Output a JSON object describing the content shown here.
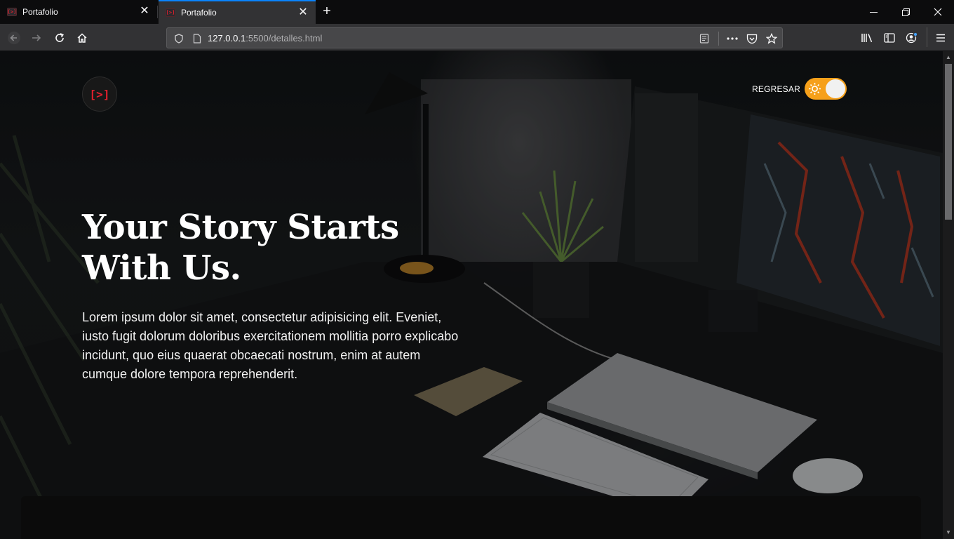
{
  "browser": {
    "tabs": [
      {
        "title": "Portafolio",
        "active": false
      },
      {
        "title": "Portafolio",
        "active": true
      }
    ],
    "tab_favicon_text": "[>]",
    "url_host": "127.0.0.1",
    "url_path": ":5500/detalles.html",
    "accent_color": "#0a84ff"
  },
  "page": {
    "logo_text": "[>]",
    "back_label": "REGRESAR",
    "theme_toggle": {
      "on": true,
      "color": "#f6a01a"
    },
    "hero": {
      "title_line1": "Your Story Starts",
      "title_line2": "With Us.",
      "text_line1": "Lorem ipsum dolor sit amet, consectetur adipisicing elit. Eveniet,",
      "text_line2": "iusto fugit dolorum doloribus exercitationem mollitia porro explicabo",
      "text_line3": "incidunt, quo eius quaerat obcaecati nostrum, enim at autem",
      "text_line4": "cumque dolore tempora reprehenderit."
    },
    "brand_color": "#e0202d"
  }
}
